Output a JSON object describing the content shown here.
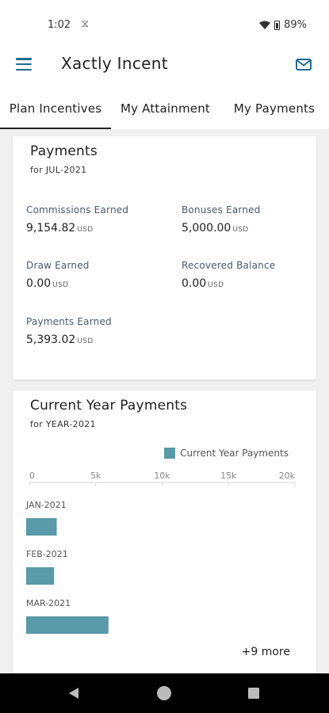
{
  "status_bar": {
    "time": "1:02",
    "battery": "89%",
    "sync_glyph": "⧖"
  },
  "app": {
    "title": "Xactly Incent",
    "accent": "#1d6b96"
  },
  "tabs": [
    {
      "label": "Plan Incentives",
      "active": true
    },
    {
      "label": "My Attainment",
      "active": false
    },
    {
      "label": "My Payments",
      "active": false
    }
  ],
  "payments": {
    "title": "Payments",
    "subtitle": "for JUL-2021",
    "metrics": [
      {
        "label": "Commissions Earned",
        "value": "9,154.82",
        "unit": "USD"
      },
      {
        "label": "Bonuses Earned",
        "value": "5,000.00",
        "unit": "USD"
      },
      {
        "label": "Draw Earned",
        "value": "0.00",
        "unit": "USD"
      },
      {
        "label": "Recovered Balance",
        "value": "0.00",
        "unit": "USD"
      },
      {
        "label": "Payments Earned",
        "value": "5,393.02",
        "unit": "USD"
      }
    ]
  },
  "current_year": {
    "title": "Current Year Payments",
    "subtitle": "for YEAR-2021",
    "more_label": "+9 more"
  },
  "chart_data": {
    "type": "bar",
    "orientation": "horizontal",
    "categories": [
      "JAN-2021",
      "FEB-2021",
      "MAR-2021"
    ],
    "series": [
      {
        "name": "Current Year Payments",
        "values": [
          2300,
          2100,
          6200
        ],
        "color": "#5b9aa8"
      }
    ],
    "xlim": [
      0,
      20000
    ],
    "x_ticks": [
      "0",
      "5k",
      "10k",
      "15k",
      "20k"
    ],
    "legend": "top-right",
    "grid": false
  }
}
